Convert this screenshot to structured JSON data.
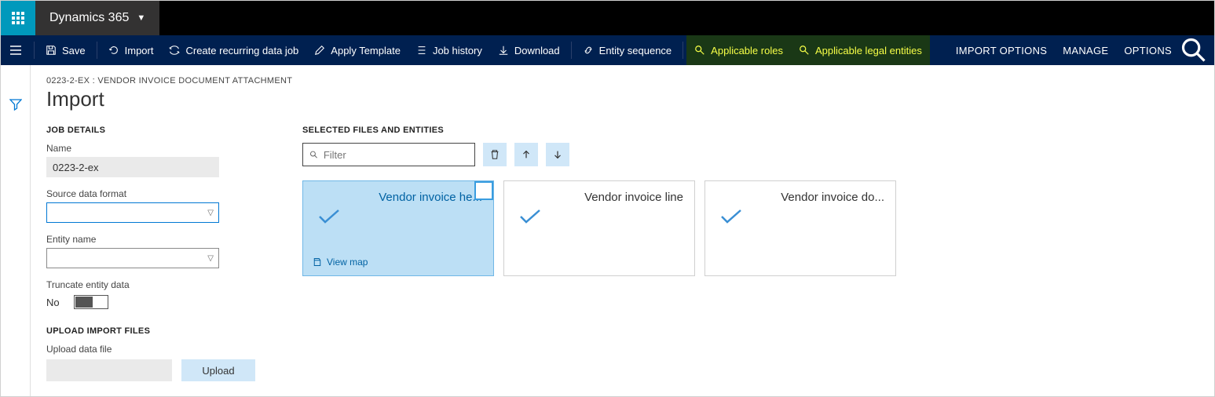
{
  "brand": "Dynamics 365",
  "actions": {
    "save": "Save",
    "import": "Import",
    "recurring": "Create recurring data job",
    "template": "Apply Template",
    "history": "Job history",
    "download": "Download",
    "sequence": "Entity sequence",
    "roles": "Applicable roles",
    "legal": "Applicable legal entities",
    "importopts": "IMPORT OPTIONS",
    "manage": "MANAGE",
    "options": "OPTIONS"
  },
  "breadcrumb": "0223-2-EX : VENDOR INVOICE DOCUMENT ATTACHMENT",
  "page_title": "Import",
  "job": {
    "section": "JOB DETAILS",
    "name_label": "Name",
    "name_value": "0223-2-ex",
    "format_label": "Source data format",
    "format_value": "",
    "entity_label": "Entity name",
    "entity_value": "",
    "truncate_label": "Truncate entity data",
    "truncate_value": "No"
  },
  "upload": {
    "section": "UPLOAD IMPORT FILES",
    "label": "Upload data file",
    "button": "Upload"
  },
  "entities": {
    "section": "SELECTED FILES AND ENTITIES",
    "filter_placeholder": "Filter",
    "viewmap": "View map",
    "cards": [
      {
        "title": "Vendor invoice he...",
        "selected": true
      },
      {
        "title": "Vendor invoice line",
        "selected": false
      },
      {
        "title": "Vendor invoice do...",
        "selected": false
      }
    ]
  }
}
